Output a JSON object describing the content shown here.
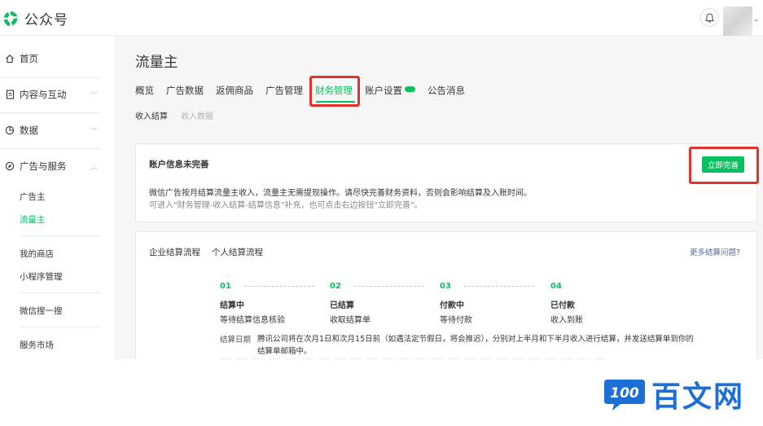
{
  "header": {
    "brand": "公众号"
  },
  "sidebar": {
    "items": [
      {
        "label": "首页"
      },
      {
        "label": "内容与互动"
      },
      {
        "label": "数据"
      },
      {
        "label": "广告与服务"
      }
    ],
    "sub_items": [
      "广告主",
      "流量主",
      "我的商店",
      "小程序管理",
      "微信搜一搜",
      "服务市场"
    ]
  },
  "main": {
    "title": "流量主",
    "tabs": [
      "概览",
      "广告数据",
      "返佣商品",
      "广告管理",
      "财务管理",
      "账户设置",
      "公告消息"
    ],
    "active_tab": "财务管理",
    "subtabs": [
      "收入结算",
      "收入数据"
    ]
  },
  "notice": {
    "title": "账户信息未完善",
    "desc1": "微信广告按月结算流量主收入，流量主无需提现操作。请尽快完善财务资料，否则会影响结算及入账时间。",
    "desc2": "可进入\"财务管理-收入结算-结算信息\"补充，也可点击右边按钮\"立即完善\"。",
    "button": "立即完善"
  },
  "process": {
    "tabs": [
      "企业结算流程",
      "个人结算流程"
    ],
    "more_link": "更多结算问题?",
    "steps": [
      {
        "num": "01",
        "title": "结算中",
        "desc": "等待结算信息核验"
      },
      {
        "num": "02",
        "title": "已结算",
        "desc": "收取结算单"
      },
      {
        "num": "03",
        "title": "付款中",
        "desc": "等待付款"
      },
      {
        "num": "04",
        "title": "已付款",
        "desc": "收入到账"
      }
    ],
    "date_label": "结算日期",
    "date_text": "腾讯公司将在次月1日和次月15日前（如遇法定节假日，将会推迟），分别对上半月和下半月收入进行结算，并发送结算单到你的结算单邮箱中。"
  },
  "watermark": {
    "text": "百文网",
    "badge": "100"
  },
  "colors": {
    "accent": "#07c160",
    "highlight": "#e4312b",
    "link": "#576b95",
    "watermark": "#1d6fd8"
  }
}
